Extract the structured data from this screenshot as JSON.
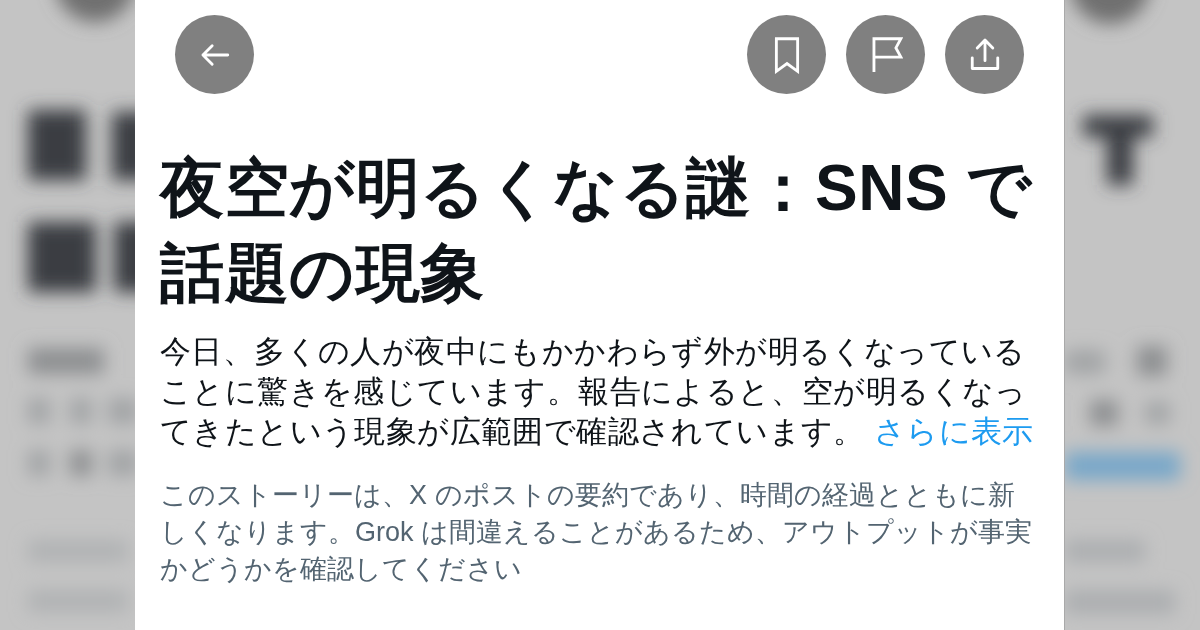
{
  "story": {
    "title": "夜空が明るくなる謎：SNS で話題の現象",
    "summary": "今日、多くの人が夜中にもかかわらず外が明るくなっていることに驚きを感じています。報告によると、空が明るくなってきたという現象が広範囲で確認されています。",
    "show_more_link": "さらに表示",
    "disclaimer": "このストーリーは、X のポストの要約であり、時間の経過とともに新しくなります。Grok は間違えることがあるため、アウトプットが事実かどうかを確認してください"
  }
}
